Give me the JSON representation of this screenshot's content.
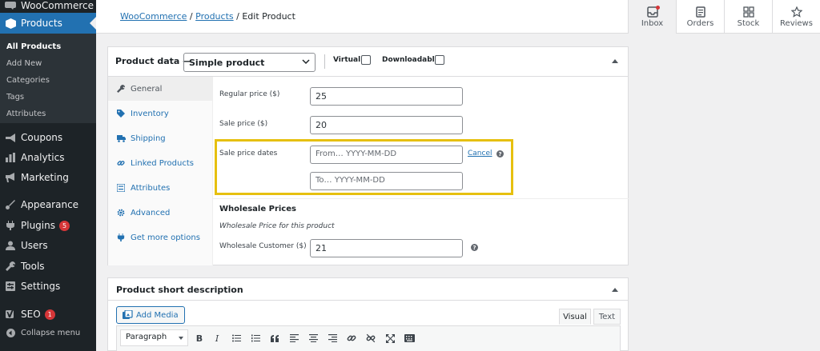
{
  "sidebar": {
    "items": [
      {
        "label": "WooCommerce"
      },
      {
        "label": "Products"
      },
      {
        "label": "Coupons"
      },
      {
        "label": "Analytics"
      },
      {
        "label": "Marketing"
      },
      {
        "label": "Appearance"
      },
      {
        "label": "Plugins",
        "badge": "5"
      },
      {
        "label": "Users"
      },
      {
        "label": "Tools"
      },
      {
        "label": "Settings"
      },
      {
        "label": "SEO",
        "badge": "1"
      },
      {
        "label": "Collapse menu"
      }
    ],
    "submenu": [
      "All Products",
      "Add New",
      "Categories",
      "Tags",
      "Attributes"
    ]
  },
  "breadcrumb": {
    "woocommerce": "WooCommerce",
    "sep1": "/",
    "products": "Products",
    "sep2": "/",
    "current": "Edit Product"
  },
  "top_tabs": [
    "Inbox",
    "Orders",
    "Stock",
    "Reviews"
  ],
  "product_data": {
    "title": "Product data —",
    "type_select": "Simple product",
    "virtual_label": "Virtual:",
    "downloadable_label": "Downloadable:",
    "tabs": [
      "General",
      "Inventory",
      "Shipping",
      "Linked Products",
      "Attributes",
      "Advanced",
      "Get more options"
    ],
    "regular_price_label": "Regular price ($)",
    "regular_price_value": "25",
    "sale_price_label": "Sale price ($)",
    "sale_price_value": "20",
    "sale_dates_label": "Sale price dates",
    "from_placeholder": "From… YYYY-MM-DD",
    "to_placeholder": "To…  YYYY-MM-DD",
    "cancel_label": "Cancel",
    "help_glyph": "?",
    "wholesale_title": "Wholesale Prices",
    "wholesale_sub": "Wholesale Price for this product",
    "wholesale_customer_label": "Wholesale Customer ($)",
    "wholesale_customer_value": "21"
  },
  "short_desc": {
    "title": "Product short description",
    "add_media": "Add Media",
    "tab_visual": "Visual",
    "tab_text": "Text",
    "paragraph": "Paragraph",
    "toolbar": [
      "B",
      "I"
    ]
  },
  "colors": {
    "accent": "#2271b1",
    "highlight": "#e6c00f",
    "sidebar": "#1d2327",
    "badge": "#d63638"
  }
}
